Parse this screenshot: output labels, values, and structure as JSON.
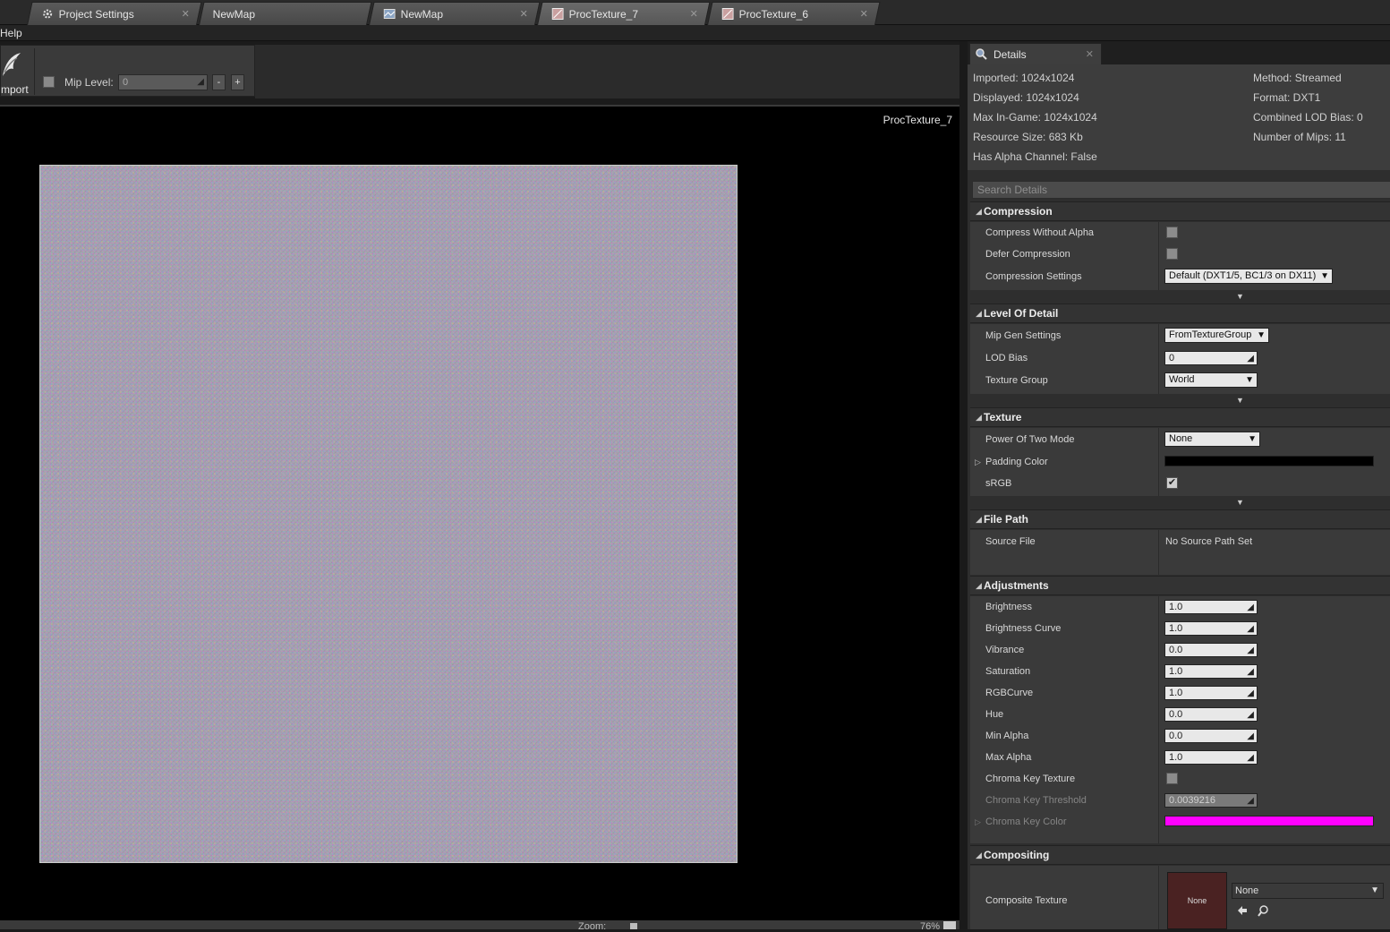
{
  "tabs": [
    {
      "label": "Project Settings",
      "icon": "gear-icon"
    },
    {
      "label": "NewMap",
      "icon": ""
    },
    {
      "label": "NewMap",
      "icon": "map-icon"
    },
    {
      "label": "ProcTexture_7",
      "icon": "texture-icon"
    },
    {
      "label": "ProcTexture_6",
      "icon": "texture-icon"
    }
  ],
  "menu": {
    "help": "Help"
  },
  "toolbar": {
    "import_label": "mport",
    "mip_label": "Mip Level:",
    "mip_value": "0",
    "minus": "-",
    "plus": "+"
  },
  "viewport": {
    "title": "ProcTexture_7"
  },
  "status": {
    "zoom_label": "Zoom:",
    "zoom_value": "76%"
  },
  "details": {
    "tab_label": "Details",
    "info_left": [
      "Imported: 1024x1024",
      "Displayed: 1024x1024",
      "Max In-Game: 1024x1024",
      "Resource Size: 683 Kb",
      "Has Alpha Channel: False"
    ],
    "info_right": [
      "Method: Streamed",
      "Format: DXT1",
      "Combined LOD Bias: 0",
      "Number of Mips: 11"
    ],
    "search_placeholder": "Search Details",
    "compression": {
      "title": "Compression",
      "compress_without_alpha": "Compress Without Alpha",
      "defer_compression": "Defer Compression",
      "compression_settings": "Compression Settings",
      "compression_settings_value": "Default (DXT1/5, BC1/3 on DX11)"
    },
    "lod": {
      "title": "Level Of Detail",
      "mip_gen_settings": "Mip Gen Settings",
      "mip_gen_value": "FromTextureGroup",
      "lod_bias": "LOD Bias",
      "lod_bias_value": "0",
      "texture_group": "Texture Group",
      "texture_group_value": "World"
    },
    "texture": {
      "title": "Texture",
      "power_of_two": "Power Of Two Mode",
      "power_of_two_value": "None",
      "padding_color": "Padding Color",
      "padding_color_hex": "#000000",
      "srgb": "sRGB"
    },
    "file_path": {
      "title": "File Path",
      "source_file": "Source File",
      "source_value": "No Source Path Set"
    },
    "adjustments": {
      "title": "Adjustments",
      "rows": [
        {
          "label": "Brightness",
          "value": "1.0"
        },
        {
          "label": "Brightness Curve",
          "value": "1.0"
        },
        {
          "label": "Vibrance",
          "value": "0.0"
        },
        {
          "label": "Saturation",
          "value": "1.0"
        },
        {
          "label": "RGBCurve",
          "value": "1.0"
        },
        {
          "label": "Hue",
          "value": "0.0"
        },
        {
          "label": "Min Alpha",
          "value": "0.0"
        },
        {
          "label": "Max Alpha",
          "value": "1.0"
        }
      ],
      "chroma_key_texture": "Chroma Key Texture",
      "chroma_key_threshold": "Chroma Key Threshold",
      "chroma_key_threshold_value": "0.0039216",
      "chroma_key_color": "Chroma Key Color",
      "chroma_key_color_hex": "#ff00ff"
    },
    "compositing": {
      "title": "Compositing",
      "composite_texture": "Composite Texture",
      "thumb_label": "None",
      "combo_value": "None"
    }
  },
  "colors": {
    "accent_magenta": "#ff00ff",
    "panel": "#2e2e2e",
    "viewport_bg": "#000000"
  }
}
